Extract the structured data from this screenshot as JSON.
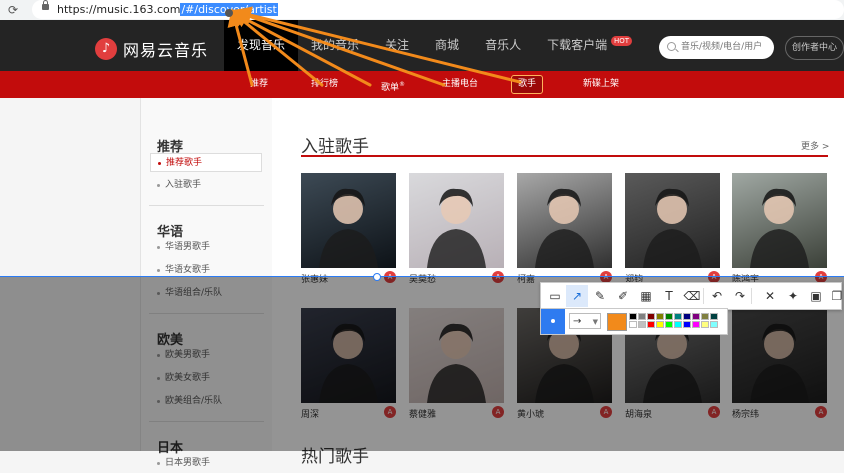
{
  "browser": {
    "url_host": "https://music.163.com",
    "url_selected": "/#/discover/artist"
  },
  "header": {
    "logo_mark": "♪",
    "logo_text": "网易云音乐",
    "nav": [
      {
        "label": "发现音乐",
        "active": true
      },
      {
        "label": "我的音乐",
        "active": false
      },
      {
        "label": "关注",
        "active": false
      },
      {
        "label": "商城",
        "active": false
      },
      {
        "label": "音乐人",
        "active": false
      },
      {
        "label": "下载客户端",
        "active": false
      }
    ],
    "hot_badge": "HOT",
    "search_placeholder": "音乐/视频/电台/用户",
    "creator_label": "创作者中心"
  },
  "subnav": {
    "items": [
      {
        "label": "推荐",
        "active": false
      },
      {
        "label": "排行榜",
        "active": false
      },
      {
        "label": "歌单",
        "active": false
      },
      {
        "label": "主播电台",
        "active": false
      },
      {
        "label": "歌手",
        "active": true
      },
      {
        "label": "新碟上架",
        "active": false
      }
    ],
    "playlist_sup": "®"
  },
  "sidebar": {
    "groups": [
      {
        "title": "推荐",
        "links": [
          {
            "label": "推荐歌手",
            "active": true
          },
          {
            "label": "入驻歌手",
            "active": false
          }
        ]
      },
      {
        "title": "华语",
        "links": [
          {
            "label": "华语男歌手",
            "active": false
          },
          {
            "label": "华语女歌手",
            "active": false
          },
          {
            "label": "华语组合/乐队",
            "active": false
          }
        ]
      },
      {
        "title": "欧美",
        "links": [
          {
            "label": "欧美男歌手",
            "active": false
          },
          {
            "label": "欧美女歌手",
            "active": false
          },
          {
            "label": "欧美组合/乐队",
            "active": false
          }
        ]
      },
      {
        "title": "日本",
        "links": [
          {
            "label": "日本男歌手",
            "active": false
          }
        ]
      }
    ]
  },
  "main": {
    "section_title": "入驻歌手",
    "more_label": "更多 >",
    "artist_badge": "A",
    "artists_row1": [
      "张惠妹",
      "吴莫愁",
      "柯嘉",
      "郑钧",
      "陈鸿宇"
    ],
    "artists_row2": [
      "周深",
      "蔡健雅",
      "黄小琥",
      "胡海泉",
      "杨宗纬"
    ],
    "hot_title": "热门歌手"
  },
  "toolbar": {
    "tools": [
      {
        "name": "rect-select-icon",
        "glyph": "▭"
      },
      {
        "name": "line-tool-icon",
        "glyph": "↗",
        "active": true
      },
      {
        "name": "pencil-icon",
        "glyph": "✎"
      },
      {
        "name": "marker-icon",
        "glyph": "✐"
      },
      {
        "name": "mosaic-icon",
        "glyph": "▦"
      },
      {
        "name": "text-tool-icon",
        "glyph": "T"
      },
      {
        "name": "eraser-icon",
        "glyph": "⌫"
      },
      {
        "name": "undo-icon",
        "glyph": "↶"
      },
      {
        "name": "redo-icon",
        "glyph": "↷"
      },
      {
        "name": "close-icon",
        "glyph": "✕"
      },
      {
        "name": "pin-icon",
        "glyph": "✦"
      },
      {
        "name": "save-icon",
        "glyph": "▣"
      },
      {
        "name": "copy-icon",
        "glyph": "❐"
      }
    ],
    "arrow_style": "→",
    "chevron": "▼",
    "current_color": "#f28a1b",
    "swatches": [
      "#000000",
      "#808080",
      "#800000",
      "#808000",
      "#008000",
      "#008080",
      "#000080",
      "#800080",
      "#808040",
      "#004040",
      "#ffffff",
      "#c0c0c0",
      "#ff0000",
      "#ffff00",
      "#00ff00",
      "#00ffff",
      "#0000ff",
      "#ff00ff",
      "#ffff80",
      "#80ffff"
    ]
  },
  "colors": {
    "brand_red": "#c20c0c",
    "topbar": "#242424",
    "annotation_orange": "#f28a1b"
  }
}
